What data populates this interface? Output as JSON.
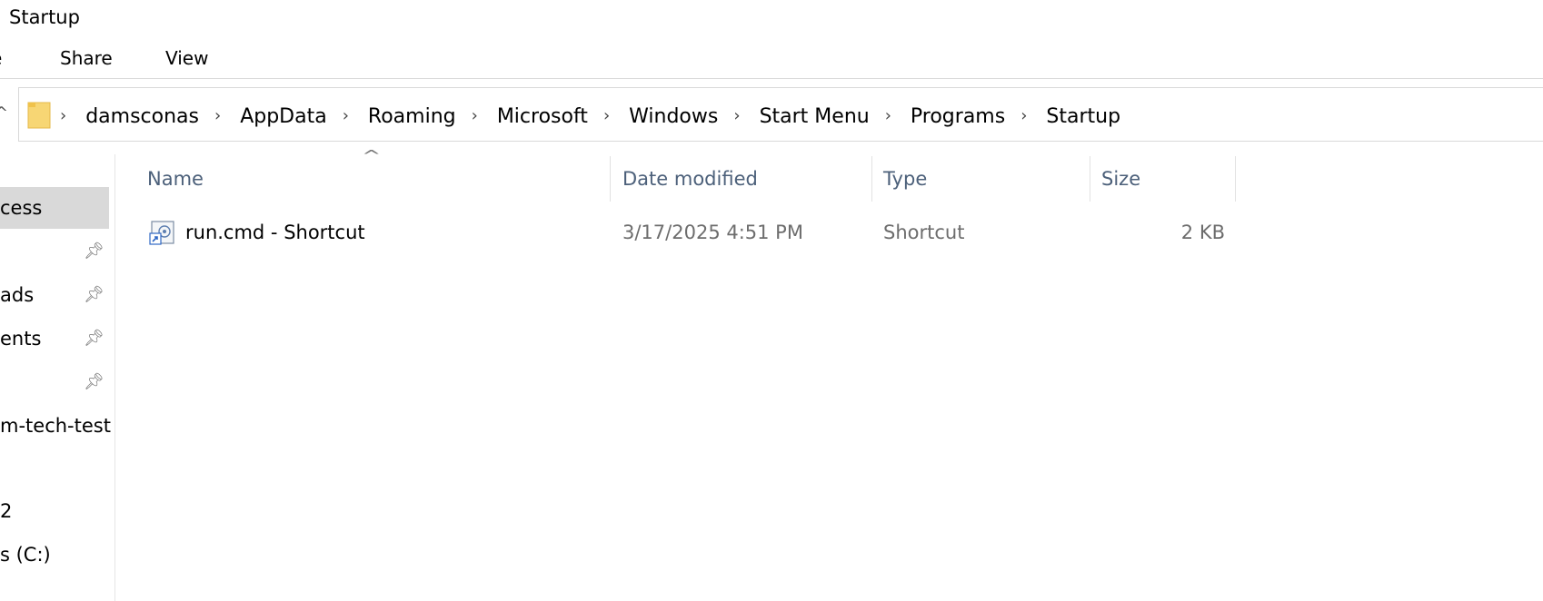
{
  "window": {
    "title": "Startup"
  },
  "ribbon": {
    "tabs": [
      "e",
      "Share",
      "View"
    ]
  },
  "address": {
    "crumbs": [
      "damsconas",
      "AppData",
      "Roaming",
      "Microsoft",
      "Windows",
      "Start Menu",
      "Programs",
      "Startup"
    ]
  },
  "nav": {
    "items": [
      {
        "label": "cess",
        "pinned": false,
        "selected": true
      },
      {
        "label": "",
        "pinned": true,
        "selected": false
      },
      {
        "label": "ads",
        "pinned": true,
        "selected": false
      },
      {
        "label": "ents",
        "pinned": true,
        "selected": false
      },
      {
        "label": "",
        "pinned": true,
        "selected": false
      },
      {
        "label": "m-tech-test",
        "pinned": false,
        "selected": false
      },
      {
        "label": "2",
        "pinned": false,
        "selected": false
      },
      {
        "label": "s (C:)",
        "pinned": false,
        "selected": false
      }
    ]
  },
  "columns": {
    "name": "Name",
    "date": "Date modified",
    "type": "Type",
    "size": "Size"
  },
  "files": [
    {
      "name": "run.cmd - Shortcut",
      "date": "3/17/2025 4:51 PM",
      "type": "Shortcut",
      "size": "2 KB",
      "icon": "shortcut-icon"
    }
  ],
  "icons": {
    "pin": "pin-icon",
    "folder": "folder-icon",
    "separator": "chevron-right-icon",
    "sort": "sort-up-icon"
  }
}
